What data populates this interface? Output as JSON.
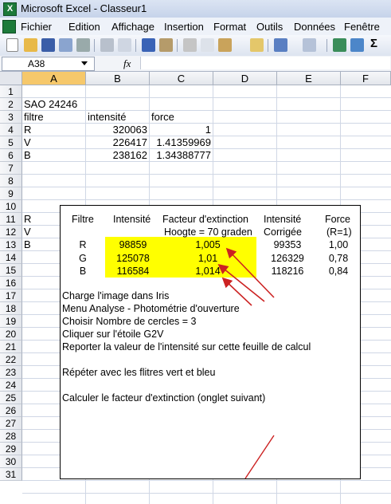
{
  "window": {
    "title": "Microsoft Excel - Classeur1",
    "app_icon": "excel-icon"
  },
  "menu": [
    "Fichier",
    "Edition",
    "Affichage",
    "Insertion",
    "Format",
    "Outils",
    "Données",
    "Fenêtre"
  ],
  "formula_bar": {
    "name_box": "A38",
    "fx": "fx",
    "formula": ""
  },
  "columns": [
    "A",
    "B",
    "C",
    "D",
    "E",
    "F"
  ],
  "rows": [
    "1",
    "2",
    "3",
    "4",
    "5",
    "6",
    "7",
    "8",
    "9",
    "10",
    "11",
    "12",
    "13",
    "14",
    "15",
    "16",
    "17",
    "18",
    "19",
    "20",
    "21",
    "22",
    "23",
    "24",
    "25",
    "26",
    "27",
    "28",
    "29",
    "30",
    "31"
  ],
  "cells": {
    "A2": "SAO 24246",
    "A3": "filtre",
    "B3": "intensité",
    "C3": "force",
    "A4": "R",
    "B4": "320063",
    "C4": "1",
    "A5": "V",
    "B5": "226417",
    "C5": "1.41359969",
    "A6": "B",
    "B6": "238162",
    "C6": "1.34388777",
    "A11": "R",
    "A12": "V",
    "A13": "B"
  },
  "overlay": {
    "headers": {
      "filtre": "Filtre",
      "intensite": "Intensité",
      "facteur": "Facteur d'extinction",
      "hoogte": "Hoogte = 70 graden",
      "intensite_corr": "Intensité",
      "corrigee": "Corrigée",
      "force": "Force",
      "force_ref": "(R=1)"
    },
    "rows": [
      {
        "filtre": "R",
        "intensite": "98859",
        "facteur": "1,005",
        "corrigee": "99353",
        "force": "1,00"
      },
      {
        "filtre": "G",
        "intensite": "125078",
        "facteur": "1,01",
        "corrigee": "126329",
        "force": "0,78"
      },
      {
        "filtre": "B",
        "intensite": "116584",
        "facteur": "1,014",
        "corrigee": "118216",
        "force": "0,84"
      }
    ],
    "instructions": [
      "Charge l'image dans Iris",
      "Menu Analyse - Photométrie d'ouverture",
      "Choisir Nombre de cercles = 3",
      "Cliquer sur l'étoile G2V",
      "Reporter la valeur de l'intensité sur cette feuille de calcul",
      "Répéter avec les flitres vert et bleu",
      "Calculer le facteur d'extinction (onglet suivant)"
    ],
    "highlight_color": "#ffff00",
    "arrow_color": "#cc2222"
  }
}
